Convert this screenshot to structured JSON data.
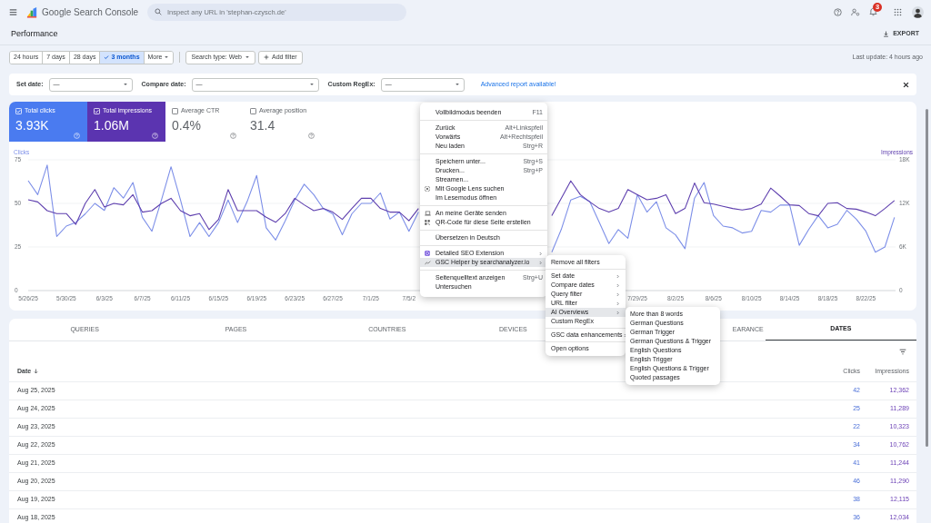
{
  "header": {
    "title": "Google Search Console",
    "search_placeholder": "Inspect any URL in 'stephan-czysch.de'",
    "notification_count": "3"
  },
  "page": {
    "title": "Performance",
    "export": "EXPORT"
  },
  "date_ranges": [
    {
      "label": "24 hours",
      "selected": false,
      "kind": "range"
    },
    {
      "label": "7 days",
      "selected": false,
      "kind": "range"
    },
    {
      "label": "28 days",
      "selected": false,
      "kind": "range"
    },
    {
      "label": "3 months",
      "selected": true,
      "kind": "range"
    },
    {
      "label": "More",
      "selected": false,
      "kind": "menu"
    }
  ],
  "filters": [
    {
      "label": "Search type: Web",
      "kind": "dropdown"
    },
    {
      "label": "Add filter",
      "kind": "add"
    }
  ],
  "last_update": "Last update: 4 hours ago",
  "filter_bar": {
    "fields": [
      {
        "label": "Set date:",
        "value": "—"
      },
      {
        "label": "Compare date:",
        "value": "—"
      },
      {
        "label": "Custom RegEx:",
        "value": "—"
      }
    ],
    "link": "Advanced report available!"
  },
  "performance": {
    "metrics": [
      {
        "label": "Total clicks",
        "value": "3.93K",
        "checked": true,
        "color": "#4a7bf0"
      },
      {
        "label": "Total impressions",
        "value": "1.06M",
        "checked": true,
        "color": "#5b34b0"
      },
      {
        "label": "Average CTR",
        "value": "0.4%",
        "checked": false
      },
      {
        "label": "Average position",
        "value": "31.4",
        "checked": false
      }
    ],
    "chart_data": {
      "type": "line",
      "ylim": [
        0,
        75
      ],
      "yticks": [
        0,
        25,
        50,
        75
      ],
      "y2lim": [
        0,
        18000
      ],
      "y2ticks": [
        {
          "value": 0,
          "label": "0"
        },
        {
          "value": 6000,
          "label": "6K"
        },
        {
          "value": 12000,
          "label": "12K"
        },
        {
          "value": 18000,
          "label": "18K"
        }
      ],
      "categories": [
        "5/26/25",
        null,
        null,
        null,
        "5/30/25",
        null,
        null,
        null,
        "6/3/25",
        null,
        null,
        null,
        "6/7/25",
        null,
        null,
        null,
        "6/11/25",
        null,
        null,
        null,
        "6/15/25",
        null,
        null,
        null,
        "6/19/25",
        null,
        null,
        null,
        "6/23/25",
        null,
        null,
        null,
        "6/27/25",
        null,
        null,
        null,
        "7/1/25",
        null,
        null,
        null,
        "7/5/2",
        null,
        null,
        null,
        null,
        null,
        null,
        null,
        null,
        null,
        null,
        null,
        null,
        null,
        null,
        null,
        null,
        null,
        null,
        null,
        null,
        null,
        null,
        null,
        "7/29/25",
        null,
        null,
        null,
        "8/2/25",
        null,
        null,
        null,
        "8/6/25",
        null,
        null,
        null,
        "8/10/25",
        null,
        null,
        null,
        "8/14/25",
        null,
        null,
        null,
        "8/18/25",
        null,
        null,
        null,
        "8/22/25",
        null,
        null,
        null
      ],
      "series": [
        {
          "name": "Clicks",
          "color": "#7d8fe8",
          "values": [
            63,
            55,
            72,
            31,
            37,
            39,
            44,
            50,
            46,
            59,
            53,
            62,
            42,
            34,
            52,
            71,
            52,
            31,
            39,
            31,
            39,
            52,
            39,
            51,
            66,
            36,
            29,
            40,
            52,
            61,
            55,
            47,
            44,
            32,
            44,
            50,
            50,
            56,
            41,
            45,
            34,
            45,
            null,
            null,
            null,
            null,
            null,
            null,
            null,
            null,
            null,
            null,
            null,
            null,
            null,
            22,
            35,
            52,
            54,
            51,
            39,
            27,
            35,
            30,
            55,
            45,
            51,
            36,
            32,
            24,
            53,
            62,
            43,
            37,
            36,
            33,
            34,
            46,
            45,
            49,
            49,
            26,
            35,
            43,
            36,
            38,
            46,
            41,
            34,
            22,
            25,
            42
          ]
        },
        {
          "name": "Impressions",
          "color": "#5e3fae",
          "axis": "y2",
          "values": [
            12500,
            12200,
            11000,
            10600,
            10600,
            9100,
            12000,
            13900,
            11500,
            12000,
            11800,
            13200,
            10800,
            11000,
            12000,
            12700,
            11000,
            10300,
            10600,
            8400,
            9800,
            13900,
            11000,
            11000,
            11000,
            10100,
            9400,
            10600,
            12700,
            11800,
            11000,
            11300,
            10800,
            9800,
            11300,
            12700,
            12700,
            11300,
            10800,
            10800,
            9600,
            11300,
            null,
            null,
            null,
            null,
            null,
            null,
            null,
            null,
            null,
            null,
            null,
            null,
            null,
            10300,
            12700,
            15100,
            13200,
            12200,
            11300,
            10800,
            11300,
            13900,
            13200,
            12500,
            12700,
            13200,
            10600,
            11300,
            14800,
            12100,
            11900,
            11600,
            11300,
            11100,
            11300,
            11900,
            14100,
            13000,
            11800,
            11700,
            10600,
            10300,
            12000,
            12100,
            11300,
            11200,
            10800,
            10300,
            11300,
            12400
          ]
        }
      ]
    }
  },
  "table": {
    "tabs": [
      {
        "label": "QUERIES",
        "selected": false
      },
      {
        "label": "PAGES",
        "selected": false
      },
      {
        "label": "COUNTRIES",
        "selected": false
      },
      {
        "label": "DEVICES",
        "selected": false
      },
      {
        "label": "EARANCE",
        "selected": false
      },
      {
        "label": "DATES",
        "selected": true
      }
    ],
    "columns": [
      "Date",
      "Clicks",
      "Impressions"
    ],
    "rows": [
      [
        "Aug 25, 2025",
        "42",
        "12,362"
      ],
      [
        "Aug 24, 2025",
        "25",
        "11,289"
      ],
      [
        "Aug 23, 2025",
        "22",
        "10,323"
      ],
      [
        "Aug 22, 2025",
        "34",
        "10,762"
      ],
      [
        "Aug 21, 2025",
        "41",
        "11,244"
      ],
      [
        "Aug 20, 2025",
        "46",
        "11,290"
      ],
      [
        "Aug 19, 2025",
        "38",
        "12,115"
      ],
      [
        "Aug 18, 2025",
        "36",
        "12,034"
      ]
    ]
  },
  "context_menu": {
    "groups": [
      [
        {
          "label": "Vollbildmodus beenden",
          "shortcut": "F11",
          "kind": "plain",
          "submenu": false,
          "selected": false
        }
      ],
      [
        {
          "label": "Zurück",
          "shortcut": "Alt+Linkspfeil",
          "kind": "plain",
          "submenu": false,
          "selected": false
        },
        {
          "label": "Vorwärts",
          "shortcut": "Alt+Rechtspfeil",
          "kind": "plain",
          "submenu": false,
          "selected": false
        },
        {
          "label": "Neu laden",
          "shortcut": "Strg+R",
          "kind": "plain",
          "submenu": false,
          "selected": false
        }
      ],
      [
        {
          "label": "Speichern unter...",
          "shortcut": "Strg+S",
          "kind": "plain",
          "submenu": false,
          "selected": false
        },
        {
          "label": "Drucken...",
          "shortcut": "Strg+P",
          "kind": "plain",
          "submenu": false,
          "selected": false
        },
        {
          "label": "Streamen...",
          "kind": "plain",
          "submenu": false,
          "selected": false
        },
        {
          "label": "Mit Google Lens suchen",
          "kind": "lens",
          "submenu": false,
          "selected": false
        },
        {
          "label": "Im Lesemodus öffnen",
          "kind": "plain",
          "submenu": false,
          "selected": false
        }
      ],
      [
        {
          "label": "An meine Geräte senden",
          "kind": "devices",
          "submenu": false,
          "selected": false
        },
        {
          "label": "QR-Code für diese Seite erstellen",
          "kind": "qr",
          "submenu": false,
          "selected": false
        }
      ],
      [
        {
          "label": "Übersetzen in Deutsch",
          "kind": "plain",
          "submenu": false,
          "selected": false
        }
      ],
      [
        {
          "label": "Detailed SEO Extension",
          "kind": "extension",
          "submenu": true,
          "selected": false
        },
        {
          "label": "GSC Helper by searchanalyzer.io",
          "kind": "helper",
          "submenu": true,
          "selected": true
        }
      ],
      [
        {
          "label": "Seitenquelltext anzeigen",
          "shortcut": "Strg+U",
          "kind": "plain",
          "submenu": false,
          "selected": false
        },
        {
          "label": "Untersuchen",
          "kind": "plain",
          "submenu": false,
          "selected": false
        }
      ]
    ]
  },
  "helper_menu": {
    "groups": [
      [
        {
          "label": "Remove all filters",
          "submenu": false,
          "selected": false
        }
      ],
      [
        {
          "label": "Set date",
          "submenu": true,
          "selected": false
        },
        {
          "label": "Compare dates",
          "submenu": true,
          "selected": false
        },
        {
          "label": "Query filter",
          "submenu": true,
          "selected": false
        },
        {
          "label": "URL filter",
          "submenu": true,
          "selected": false
        },
        {
          "label": "AI Overviews",
          "submenu": true,
          "selected": true
        },
        {
          "label": "Custom RegEx",
          "submenu": false,
          "selected": false
        }
      ],
      [
        {
          "label": "GSC data enhancements",
          "submenu": true,
          "selected": false
        }
      ],
      [
        {
          "label": "Open options",
          "submenu": false,
          "selected": false
        }
      ]
    ]
  },
  "ai_overviews_menu": {
    "items": [
      "More than 8 words",
      "German Questions",
      "German Trigger",
      "German Questions & Trigger",
      "English Questions",
      "English Trigger",
      "English Questions & Trigger",
      "Quoted passages"
    ]
  }
}
